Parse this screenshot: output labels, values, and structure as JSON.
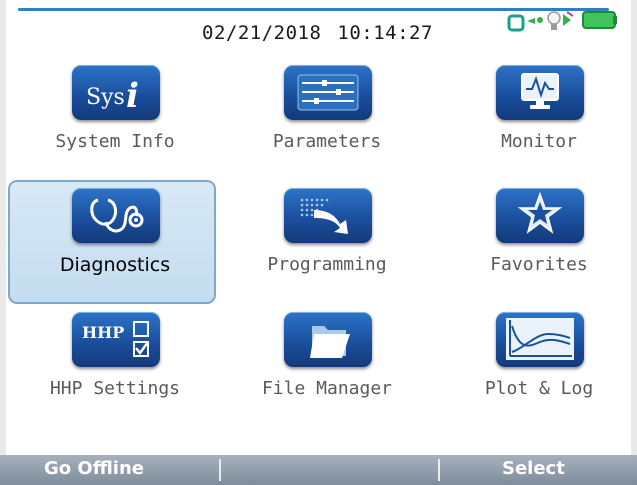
{
  "header": {
    "date": "02/21/2018",
    "time": "10:14:27",
    "status_icons": [
      "connection-icon",
      "signal-icon",
      "plug-icon",
      "battery-icon"
    ]
  },
  "menu": {
    "selected": "Diagnostics",
    "items": [
      {
        "label": "System Info",
        "icon": "sysi-icon"
      },
      {
        "label": "Parameters",
        "icon": "sliders-icon"
      },
      {
        "label": "Monitor",
        "icon": "monitor-icon"
      },
      {
        "label": "Diagnostics",
        "icon": "stethoscope-icon"
      },
      {
        "label": "Programming",
        "icon": "programming-arrow-icon"
      },
      {
        "label": "Favorites",
        "icon": "star-icon"
      },
      {
        "label": "HHP Settings",
        "icon": "hhp-checkbox-icon"
      },
      {
        "label": "File Manager",
        "icon": "folder-icon"
      },
      {
        "label": "Plot & Log",
        "icon": "plot-icon"
      }
    ]
  },
  "softkeys": {
    "left": "Go Offline",
    "middle": "",
    "right": "Select"
  },
  "icon_text": {
    "sys": "Sys",
    "i": "i",
    "hhp": "HHP"
  },
  "colors": {
    "accent_blue": "#1b4f9e",
    "selection_fill": "#c3dcef",
    "softkey_bar": "#8a96a3"
  }
}
